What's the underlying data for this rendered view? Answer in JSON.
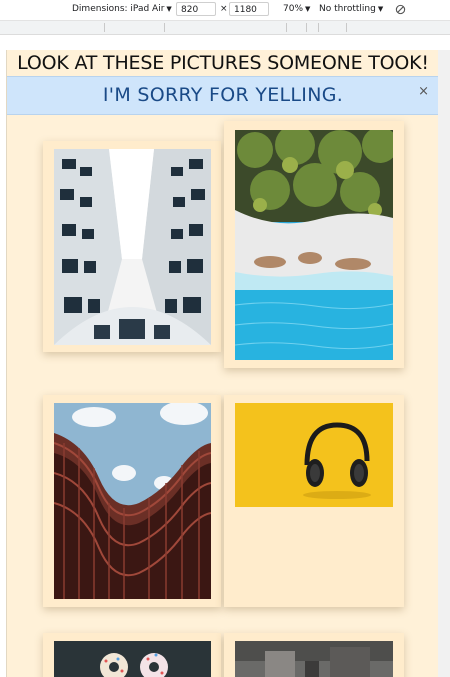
{
  "devtools": {
    "dimensions_label": "Dimensions: iPad Air",
    "width_value": "820",
    "times": "×",
    "height_value": "1180",
    "zoom": "70%",
    "throttling": "No throttling"
  },
  "page": {
    "headline": "LOOK AT THESE PICTURES SOMEONE TOOK!",
    "banner_text": "I'M SORRY FOR YELLING.",
    "banner_close": "×"
  },
  "colors": {
    "page_background": "#fff1d8",
    "banner_background": "#cfe5fb",
    "banner_text": "#1a4a87"
  },
  "photos": [
    {
      "name": "photo-curved-building"
    },
    {
      "name": "photo-aerial-beach-palms"
    },
    {
      "name": "photo-wavy-building"
    },
    {
      "name": "photo-headphones-yellow"
    },
    {
      "name": "photo-donuts"
    },
    {
      "name": "photo-street"
    }
  ]
}
